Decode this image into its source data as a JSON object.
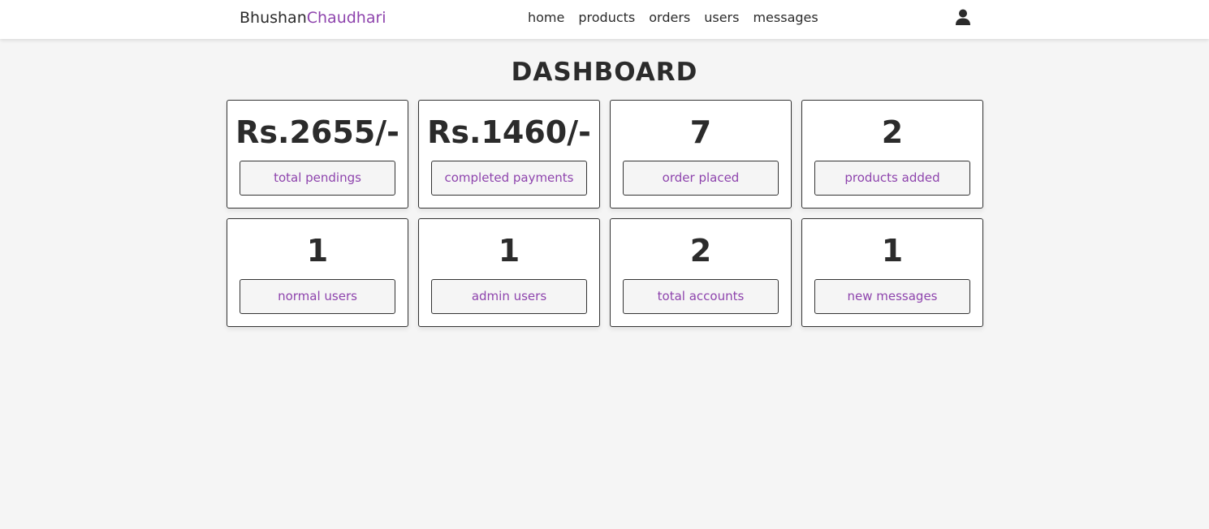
{
  "header": {
    "logo_first": "Bhushan",
    "logo_last": "Chaudhari",
    "nav": [
      "home",
      "products",
      "orders",
      "users",
      "messages"
    ],
    "user_icon": "user-icon"
  },
  "page": {
    "title": "DASHBOARD"
  },
  "cards": [
    {
      "value": "Rs.2655/-",
      "label": "total pendings"
    },
    {
      "value": "Rs.1460/-",
      "label": "completed payments"
    },
    {
      "value": "7",
      "label": "order placed"
    },
    {
      "value": "2",
      "label": "products added"
    },
    {
      "value": "1",
      "label": "normal users"
    },
    {
      "value": "1",
      "label": "admin users"
    },
    {
      "value": "2",
      "label": "total accounts"
    },
    {
      "value": "1",
      "label": "new messages"
    }
  ],
  "colors": {
    "accent": "#8e44ad",
    "background": "#f5f5f5",
    "text": "#2b2b2b"
  }
}
